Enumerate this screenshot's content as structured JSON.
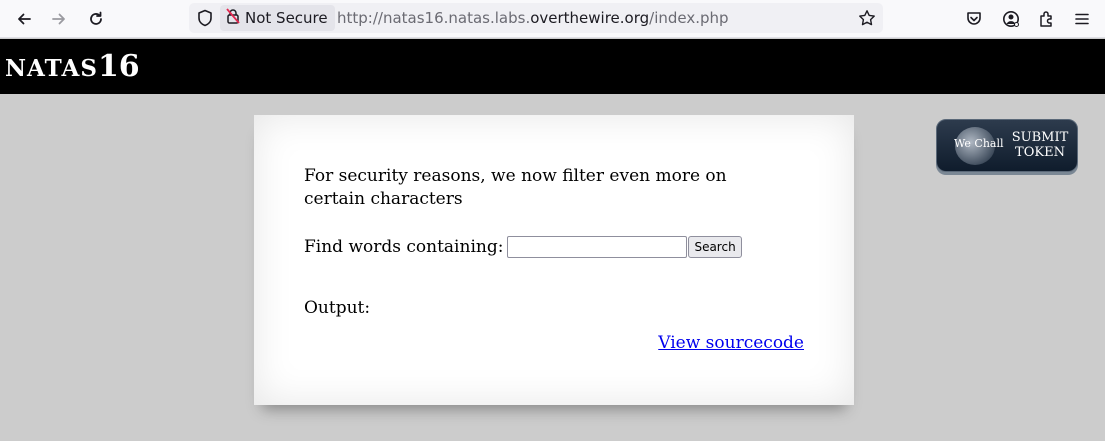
{
  "browser": {
    "security_label": "Not Secure",
    "url_prefix": "http://natas16.natas.labs.",
    "url_domain": "overthewire.org",
    "url_path": "/index.php",
    "icons": [
      "back-icon",
      "forward-icon",
      "reload-icon",
      "shield-icon",
      "insecure-lock-icon",
      "star-icon",
      "pocket-icon",
      "account-icon",
      "extensions-icon",
      "menu-icon"
    ]
  },
  "header": {
    "title_prefix": "NATAS",
    "title_number": "16"
  },
  "content": {
    "message": "For security reasons, we now filter even more on certain characters",
    "find_label": "Find words containing:",
    "find_value": "",
    "search_button": "Search",
    "output_label": "Output:",
    "source_link": "View sourcecode"
  },
  "token_button": {
    "brand": "We Chall",
    "label": "SUBMIT\nTOKEN"
  },
  "colors": {
    "background": "#cccccc",
    "header": "#000000",
    "link": "#0000ee"
  }
}
